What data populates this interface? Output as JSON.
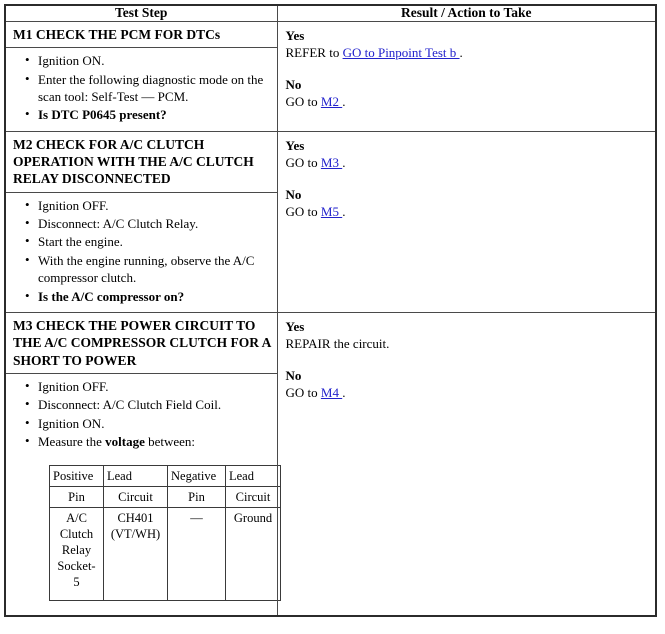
{
  "table": {
    "headers": {
      "test_step": "Test Step",
      "result_action": "Result / Action to Take"
    },
    "steps": [
      {
        "id": "M1",
        "title": "M1 CHECK THE PCM FOR DTCs",
        "items": [
          "Ignition ON.",
          "Enter the following diagnostic mode on the scan tool: Self-Test — PCM.",
          "Is DTC P0645 present?"
        ],
        "result": {
          "yes_label": "Yes",
          "yes_prefix": "REFER to ",
          "yes_link": "GO to Pinpoint Test b ",
          "yes_suffix": ".",
          "no_label": "No",
          "no_prefix": "GO to ",
          "no_link": "M2 ",
          "no_suffix": "."
        }
      },
      {
        "id": "M2",
        "title": "M2 CHECK FOR A/C CLUTCH OPERATION WITH THE A/C CLUTCH RELAY DISCONNECTED",
        "items": [
          "Ignition OFF.",
          "Disconnect: A/C Clutch Relay.",
          "Start the engine.",
          "With the engine running, observe the A/C compressor clutch.",
          "Is the A/C compressor on?"
        ],
        "result": {
          "yes_label": "Yes",
          "yes_prefix": "GO to ",
          "yes_link": "M3 ",
          "yes_suffix": ".",
          "no_label": "No",
          "no_prefix": "GO to ",
          "no_link": "M5 ",
          "no_suffix": "."
        }
      },
      {
        "id": "M3",
        "title": "M3 CHECK THE POWER CIRCUIT TO THE A/C COMPRESSOR CLUTCH FOR A SHORT TO POWER",
        "items": [
          "Ignition OFF.",
          "Disconnect: A/C Clutch Field Coil.",
          "Ignition ON.",
          "Measure the voltage between:"
        ],
        "measure_bold_word": "voltage",
        "result": {
          "yes_label": "Yes",
          "yes_prefix": "REPAIR the circuit.",
          "yes_link": "",
          "yes_suffix": "",
          "no_label": "No",
          "no_prefix": "GO to ",
          "no_link": "M4 ",
          "no_suffix": "."
        },
        "measurement_table": {
          "group_headers": [
            "Positive Lead",
            "Negative Lead"
          ],
          "group_header_cells": [
            "Positive",
            "Lead",
            "Negative",
            "Lead"
          ],
          "sub_headers": [
            "Pin",
            "Circuit",
            "Pin",
            "Circuit"
          ],
          "row": [
            "A/C Clutch Relay Socket-5",
            "CH401 (VT/WH)",
            "—",
            "Ground"
          ],
          "row_cells": [
            {
              "line1": "A/C",
              "line2": "Clutch",
              "line3": "Relay",
              "line4": "Socket-",
              "line5": "5"
            },
            {
              "line1": "CH401",
              "line2": "(VT/WH)"
            },
            {
              "line1": "—"
            },
            {
              "line1": "Ground"
            }
          ]
        }
      }
    ]
  },
  "colors": {
    "link": "#2222cc",
    "border": "#3a3a3a",
    "text": "#000000",
    "background": "#ffffff"
  }
}
